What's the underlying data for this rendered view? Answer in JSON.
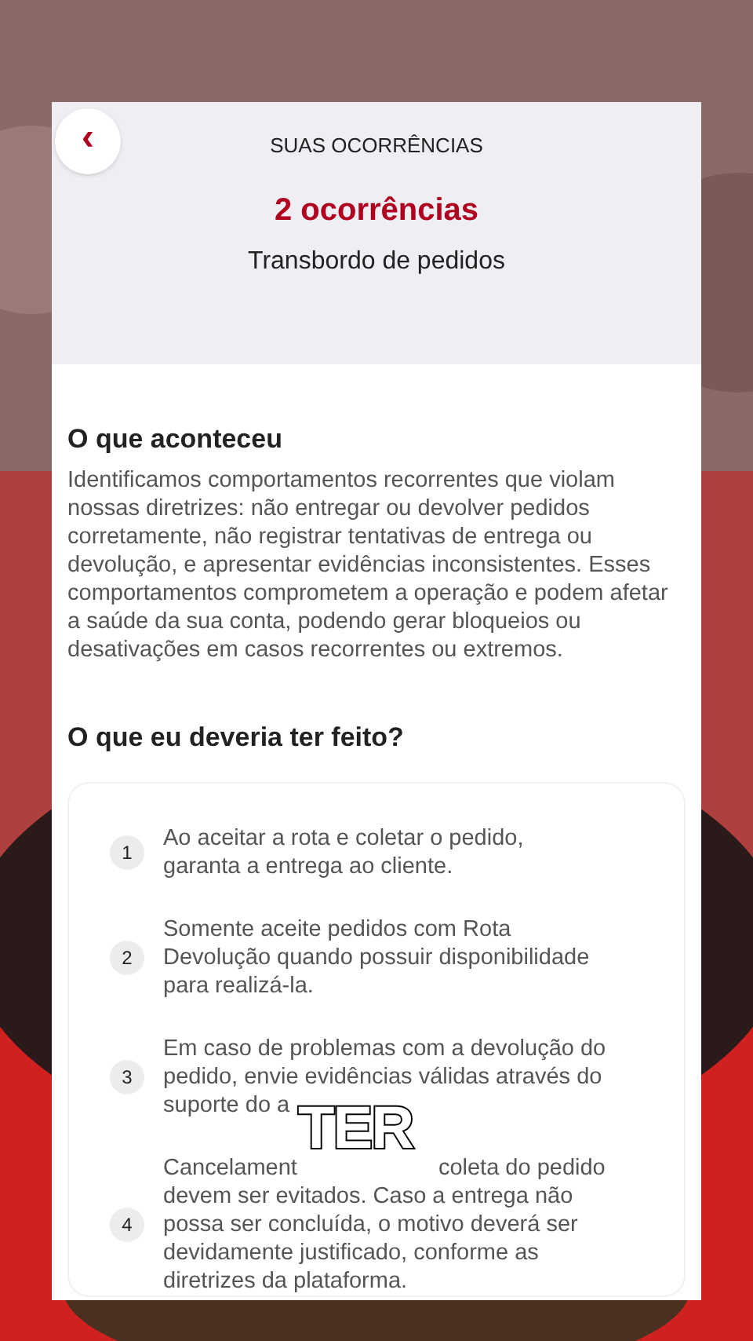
{
  "header": {
    "back": "‹",
    "title": "SUAS OCORRÊNCIAS",
    "count": "2 ocorrências",
    "subtitle": "Transbordo de pedidos"
  },
  "section1": {
    "heading": "O que aconteceu",
    "body": "Identificamos comportamentos recorrentes que violam nossas diretrizes: não entregar ou devolver pedidos corretamente, não registrar tentativas de entrega ou devolução, e apresentar evidências inconsistentes. Esses comportamentos comprometem a operação e podem afetar a saúde da sua conta, podendo gerar bloqueios ou desativações em casos recorrentes ou extremos."
  },
  "section2": {
    "heading": "O que eu deveria ter feito?",
    "steps": [
      {
        "number": "1",
        "lines": [
          [
            "Ao aceitar a rota e coletar o pedido,"
          ],
          [
            "garanta a entrega ao cliente."
          ]
        ]
      },
      {
        "number": "2",
        "lines": [
          [
            "Somente aceite pedidos com Rota"
          ],
          [
            "Devolução quando possuir disponibilidade"
          ],
          [
            "para realizá-la."
          ]
        ]
      },
      {
        "number": "3",
        "lines": [
          [
            "Em caso de problemas com a devolução do"
          ],
          [
            "pedido, envie evidências válidas através do"
          ],
          [
            "suporte do a"
          ]
        ]
      },
      {
        "number": "4",
        "lines": [
          [
            "Cancelament",
            "coleta do pedido"
          ],
          [
            "devem ser evitados. Caso a entrega não"
          ],
          [
            "possa ser concluída, o motivo deverá ser"
          ],
          [
            "devidamente justificado, conforme as"
          ],
          [
            "diretrizes da plataforma."
          ]
        ]
      }
    ]
  },
  "caption": "TER"
}
